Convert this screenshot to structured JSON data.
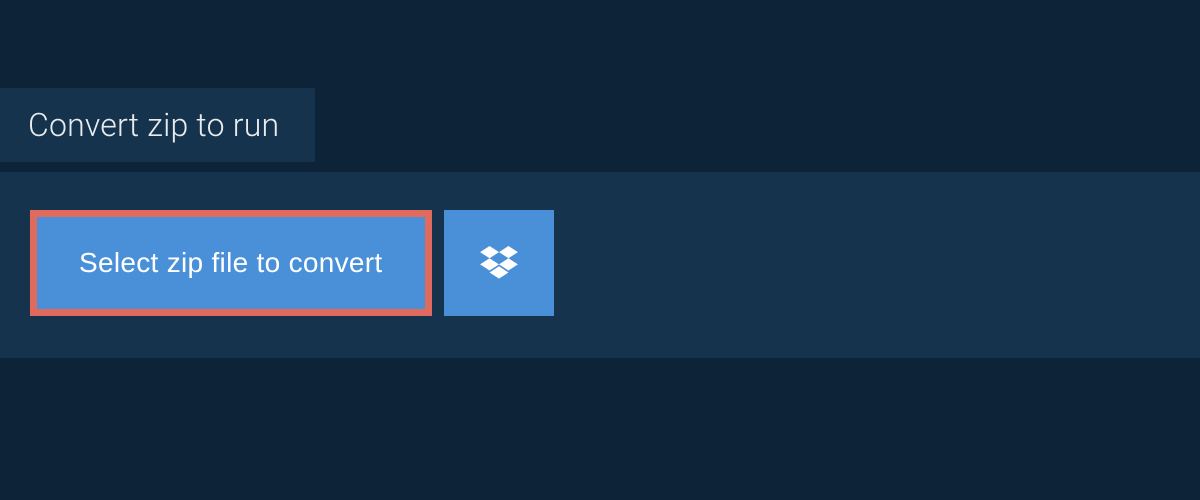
{
  "tab": {
    "title": "Convert zip to run"
  },
  "panel": {
    "select_button_label": "Select zip file to convert",
    "dropbox_icon_name": "dropbox-icon"
  },
  "colors": {
    "background": "#0d2438",
    "panel": "#16334d",
    "button": "#4a90d9",
    "highlight_border": "#e16a5f",
    "text_light": "#e8ecef",
    "text_white": "#ffffff"
  }
}
